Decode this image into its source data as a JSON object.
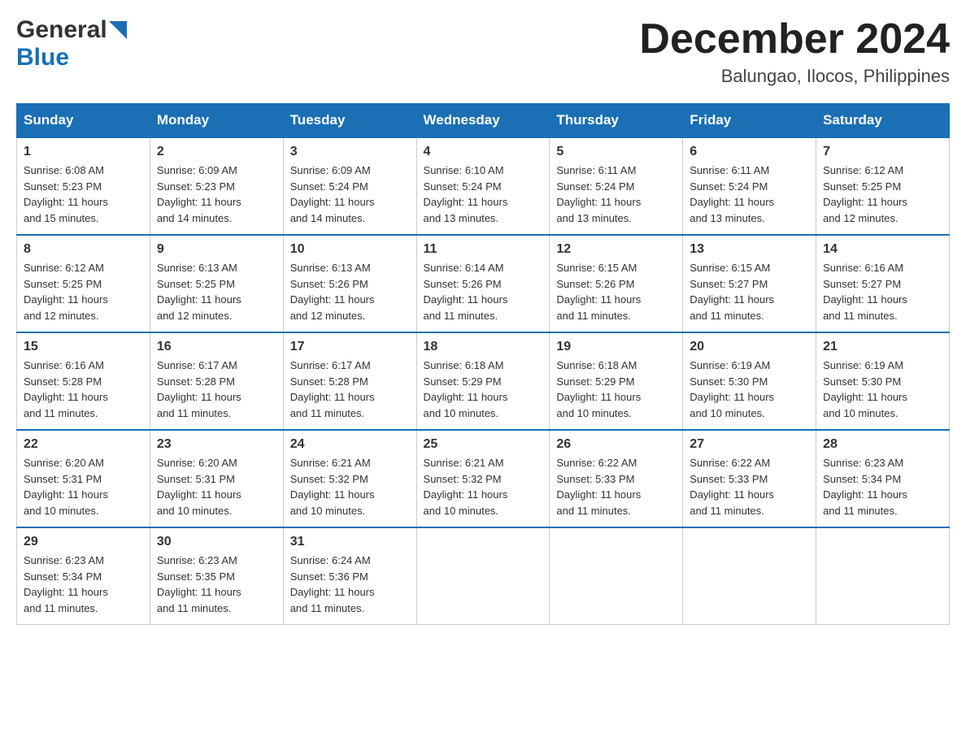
{
  "logo": {
    "general": "General",
    "blue": "Blue"
  },
  "header": {
    "title": "December 2024",
    "subtitle": "Balungao, Ilocos, Philippines"
  },
  "days_of_week": [
    "Sunday",
    "Monday",
    "Tuesday",
    "Wednesday",
    "Thursday",
    "Friday",
    "Saturday"
  ],
  "weeks": [
    [
      {
        "date": "1",
        "sunrise": "6:08 AM",
        "sunset": "5:23 PM",
        "daylight": "11 hours and 15 minutes."
      },
      {
        "date": "2",
        "sunrise": "6:09 AM",
        "sunset": "5:23 PM",
        "daylight": "11 hours and 14 minutes."
      },
      {
        "date": "3",
        "sunrise": "6:09 AM",
        "sunset": "5:24 PM",
        "daylight": "11 hours and 14 minutes."
      },
      {
        "date": "4",
        "sunrise": "6:10 AM",
        "sunset": "5:24 PM",
        "daylight": "11 hours and 13 minutes."
      },
      {
        "date": "5",
        "sunrise": "6:11 AM",
        "sunset": "5:24 PM",
        "daylight": "11 hours and 13 minutes."
      },
      {
        "date": "6",
        "sunrise": "6:11 AM",
        "sunset": "5:24 PM",
        "daylight": "11 hours and 13 minutes."
      },
      {
        "date": "7",
        "sunrise": "6:12 AM",
        "sunset": "5:25 PM",
        "daylight": "11 hours and 12 minutes."
      }
    ],
    [
      {
        "date": "8",
        "sunrise": "6:12 AM",
        "sunset": "5:25 PM",
        "daylight": "11 hours and 12 minutes."
      },
      {
        "date": "9",
        "sunrise": "6:13 AM",
        "sunset": "5:25 PM",
        "daylight": "11 hours and 12 minutes."
      },
      {
        "date": "10",
        "sunrise": "6:13 AM",
        "sunset": "5:26 PM",
        "daylight": "11 hours and 12 minutes."
      },
      {
        "date": "11",
        "sunrise": "6:14 AM",
        "sunset": "5:26 PM",
        "daylight": "11 hours and 11 minutes."
      },
      {
        "date": "12",
        "sunrise": "6:15 AM",
        "sunset": "5:26 PM",
        "daylight": "11 hours and 11 minutes."
      },
      {
        "date": "13",
        "sunrise": "6:15 AM",
        "sunset": "5:27 PM",
        "daylight": "11 hours and 11 minutes."
      },
      {
        "date": "14",
        "sunrise": "6:16 AM",
        "sunset": "5:27 PM",
        "daylight": "11 hours and 11 minutes."
      }
    ],
    [
      {
        "date": "15",
        "sunrise": "6:16 AM",
        "sunset": "5:28 PM",
        "daylight": "11 hours and 11 minutes."
      },
      {
        "date": "16",
        "sunrise": "6:17 AM",
        "sunset": "5:28 PM",
        "daylight": "11 hours and 11 minutes."
      },
      {
        "date": "17",
        "sunrise": "6:17 AM",
        "sunset": "5:28 PM",
        "daylight": "11 hours and 11 minutes."
      },
      {
        "date": "18",
        "sunrise": "6:18 AM",
        "sunset": "5:29 PM",
        "daylight": "11 hours and 10 minutes."
      },
      {
        "date": "19",
        "sunrise": "6:18 AM",
        "sunset": "5:29 PM",
        "daylight": "11 hours and 10 minutes."
      },
      {
        "date": "20",
        "sunrise": "6:19 AM",
        "sunset": "5:30 PM",
        "daylight": "11 hours and 10 minutes."
      },
      {
        "date": "21",
        "sunrise": "6:19 AM",
        "sunset": "5:30 PM",
        "daylight": "11 hours and 10 minutes."
      }
    ],
    [
      {
        "date": "22",
        "sunrise": "6:20 AM",
        "sunset": "5:31 PM",
        "daylight": "11 hours and 10 minutes."
      },
      {
        "date": "23",
        "sunrise": "6:20 AM",
        "sunset": "5:31 PM",
        "daylight": "11 hours and 10 minutes."
      },
      {
        "date": "24",
        "sunrise": "6:21 AM",
        "sunset": "5:32 PM",
        "daylight": "11 hours and 10 minutes."
      },
      {
        "date": "25",
        "sunrise": "6:21 AM",
        "sunset": "5:32 PM",
        "daylight": "11 hours and 10 minutes."
      },
      {
        "date": "26",
        "sunrise": "6:22 AM",
        "sunset": "5:33 PM",
        "daylight": "11 hours and 11 minutes."
      },
      {
        "date": "27",
        "sunrise": "6:22 AM",
        "sunset": "5:33 PM",
        "daylight": "11 hours and 11 minutes."
      },
      {
        "date": "28",
        "sunrise": "6:23 AM",
        "sunset": "5:34 PM",
        "daylight": "11 hours and 11 minutes."
      }
    ],
    [
      {
        "date": "29",
        "sunrise": "6:23 AM",
        "sunset": "5:34 PM",
        "daylight": "11 hours and 11 minutes."
      },
      {
        "date": "30",
        "sunrise": "6:23 AM",
        "sunset": "5:35 PM",
        "daylight": "11 hours and 11 minutes."
      },
      {
        "date": "31",
        "sunrise": "6:24 AM",
        "sunset": "5:36 PM",
        "daylight": "11 hours and 11 minutes."
      },
      null,
      null,
      null,
      null
    ]
  ],
  "labels": {
    "sunrise": "Sunrise:",
    "sunset": "Sunset:",
    "daylight": "Daylight:"
  },
  "colors": {
    "header_bg": "#1a6fb5",
    "header_text": "#ffffff",
    "border_top": "#1a6fb5"
  }
}
